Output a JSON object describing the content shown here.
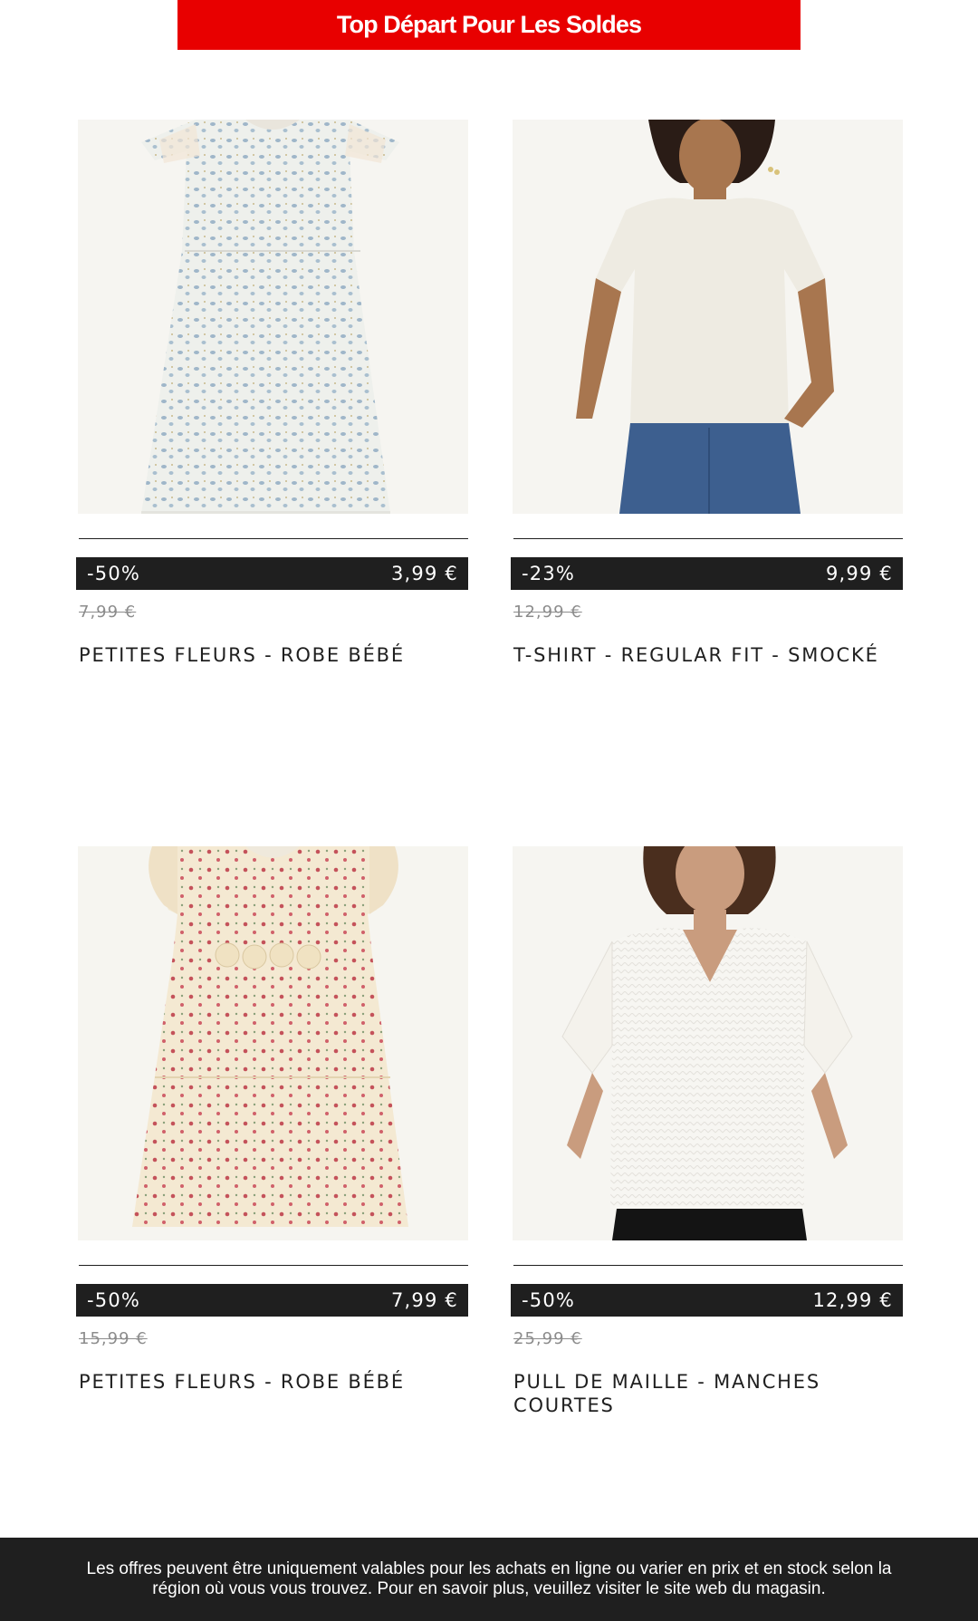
{
  "banner": {
    "label": "Top Départ Pour Les Soldes",
    "color": "#e80000"
  },
  "products": [
    {
      "image_alt": "Robe bébé à petites fleurs bleues",
      "discount": "-50%",
      "price": "3,99 €",
      "old_price": "7,99 €",
      "name": "PETITES FLEURS - ROBE BÉBÉ"
    },
    {
      "image_alt": "T-shirt écru porté avec un jean",
      "discount": "-23%",
      "price": "9,99 €",
      "old_price": "12,99 €",
      "name": "T-SHIRT - REGULAR FIT - SMOCKÉ"
    },
    {
      "image_alt": "Robe bébé crème à petites fleurs rouges",
      "discount": "-50%",
      "price": "7,99 €",
      "old_price": "15,99 €",
      "name": "PETITES FLEURS - ROBE BÉBÉ"
    },
    {
      "image_alt": "Pull de maille blanc à manches courtes",
      "discount": "-50%",
      "price": "12,99 €",
      "old_price": "25,99 €",
      "name": "PULL DE MAILLE - MANCHES COURTES"
    }
  ],
  "footer": {
    "text": "Les offres peuvent être uniquement valables pour les achats en ligne ou varier en prix et en stock selon la région où vous vous trouvez. Pour en savoir plus, veuillez visiter le site web du magasin."
  },
  "colors": {
    "price_bar": "#1f1f1f",
    "old_price": "#8c8c8c",
    "footer_bg": "#1f1f1f"
  }
}
